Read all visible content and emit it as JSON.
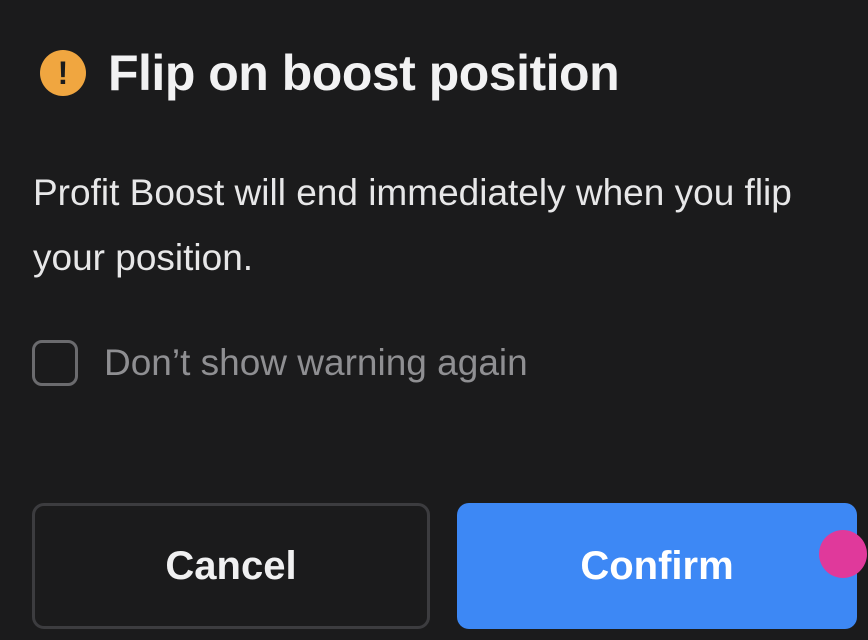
{
  "dialog": {
    "title": "Flip on boost position",
    "message": "Profit Boost will end immediately when you flip your position.",
    "warning_icon_glyph": "!",
    "icon": "warning-icon",
    "checkbox": {
      "label": "Don’t show warning again",
      "checked": false
    },
    "buttons": {
      "cancel_label": "Cancel",
      "confirm_label": "Confirm"
    }
  },
  "colors": {
    "background": "#1b1b1c",
    "warning": "#f0a640",
    "confirm": "#3d88f5",
    "touch_indicator": "#e0399b"
  }
}
